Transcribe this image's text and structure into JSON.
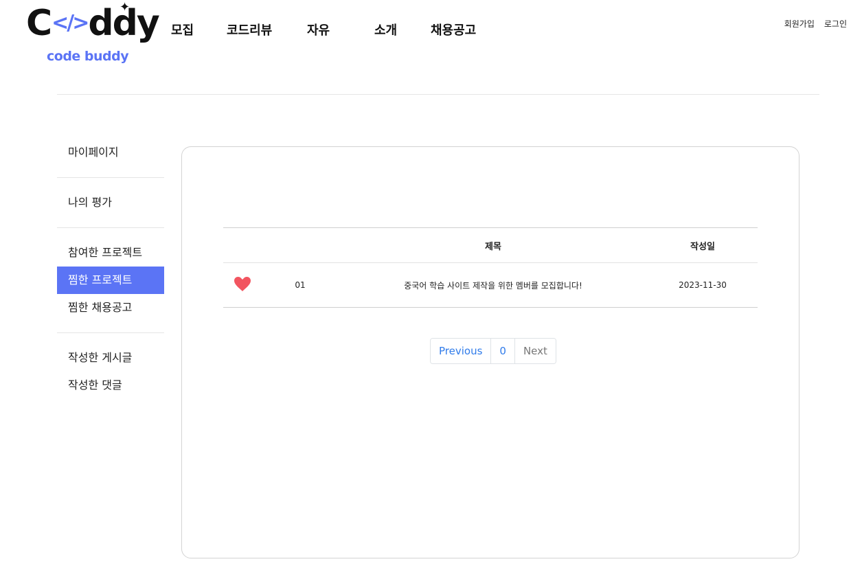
{
  "logo": {
    "left": "C",
    "bracket": "</>",
    "right": "ddy",
    "sparkle": "✦",
    "sub": "code buddy",
    "accent": "#5b74f5"
  },
  "nav": [
    "모집",
    "코드리뷰",
    "자유",
    "소개",
    "채용공고"
  ],
  "auth": {
    "signup": "회원가입",
    "login": "로그인"
  },
  "sidebar": {
    "groups": [
      [
        {
          "label": "마이페이지",
          "active": false
        }
      ],
      [
        {
          "label": "나의 평가",
          "active": false
        }
      ],
      [
        {
          "label": "참여한 프로젝트",
          "active": false
        },
        {
          "label": "찜한 프로젝트",
          "active": true
        },
        {
          "label": "찜한 채용공고",
          "active": false
        }
      ],
      [
        {
          "label": "작성한 게시글",
          "active": false
        },
        {
          "label": "작성한 댓글",
          "active": false
        }
      ]
    ]
  },
  "table": {
    "headers": [
      "",
      "",
      "제목",
      "작성일"
    ],
    "rows": [
      {
        "liked": true,
        "icon": "heart-icon",
        "num": "01",
        "title": "중국어 학습 사이트 제작을 위한 멤버를 모집합니다!",
        "date": "2023-11-30"
      }
    ]
  },
  "pagination": {
    "prev": "Previous",
    "current": "0",
    "next": "Next"
  },
  "colors": {
    "active": "#5b74f5",
    "heart": "#f25560",
    "link": "#2f7bea"
  }
}
